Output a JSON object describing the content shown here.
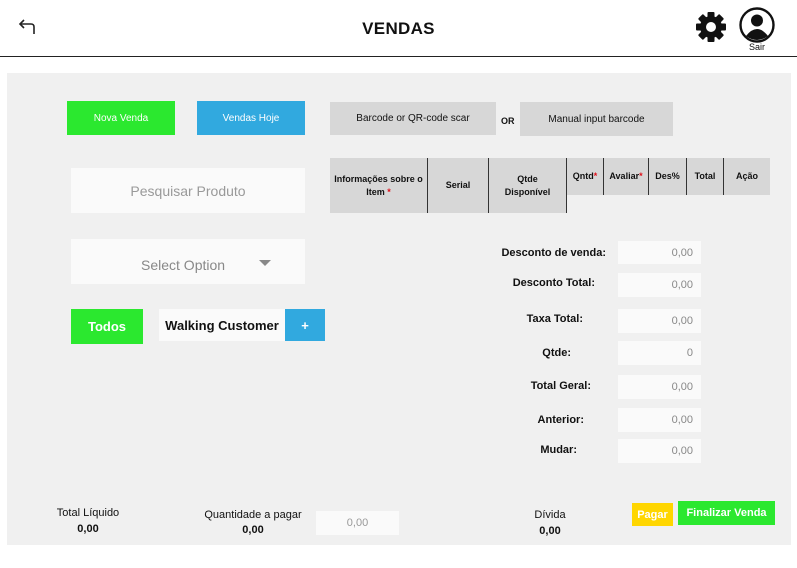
{
  "header": {
    "title": "VENDAS",
    "logout_label": "Sair"
  },
  "actions": {
    "new_sale": "Nova Venda",
    "sales_today": "Vendas Hoje",
    "barcode_scan": "Barcode or QR-code scar",
    "or_label": "OR",
    "manual_barcode": "Manual input barcode"
  },
  "search": {
    "placeholder": "Pesquisar Produto"
  },
  "select": {
    "value": "Select Option"
  },
  "customer": {
    "all_button": "Todos",
    "name": "Walking Customer",
    "add_button": "+"
  },
  "table": {
    "columns": [
      {
        "label": "Informações sobre o Item",
        "required": true
      },
      {
        "label": "Serial",
        "required": false
      },
      {
        "label": "Qtde Disponível",
        "required": false
      },
      {
        "label": "Qntd",
        "required": true
      },
      {
        "label": "Avaliar",
        "required": true
      },
      {
        "label": "Des%",
        "required": false
      },
      {
        "label": "Total",
        "required": false
      },
      {
        "label": "Ação",
        "required": false
      }
    ],
    "required_mark": "*"
  },
  "summary": [
    {
      "label": "Desconto de venda:",
      "value": "0,00"
    },
    {
      "label": "Desconto Total:",
      "value": "0,00"
    },
    {
      "label": "Taxa Total:",
      "value": "0,00"
    },
    {
      "label": "Qtde:",
      "value": "0"
    },
    {
      "label": "Total Geral:",
      "value": "0,00"
    },
    {
      "label": "Anterior:",
      "value": "0,00"
    },
    {
      "label": "Mudar:",
      "value": "0,00"
    }
  ],
  "footer": {
    "net_total_label": "Total Líquido",
    "net_total_value": "0,00",
    "amount_to_pay_label": "Quantidade a pagar",
    "amount_to_pay_value": "0,00",
    "amount_input_placeholder": "0,00",
    "debt_label": "Dívida",
    "debt_value": "0,00",
    "pay_button": "Pagar",
    "finalize_button": "Finalizar Venda"
  },
  "colors": {
    "green": "#2be82f",
    "blue": "#31a9df",
    "yellow": "#ffd600",
    "required_red": "#e0101a"
  }
}
